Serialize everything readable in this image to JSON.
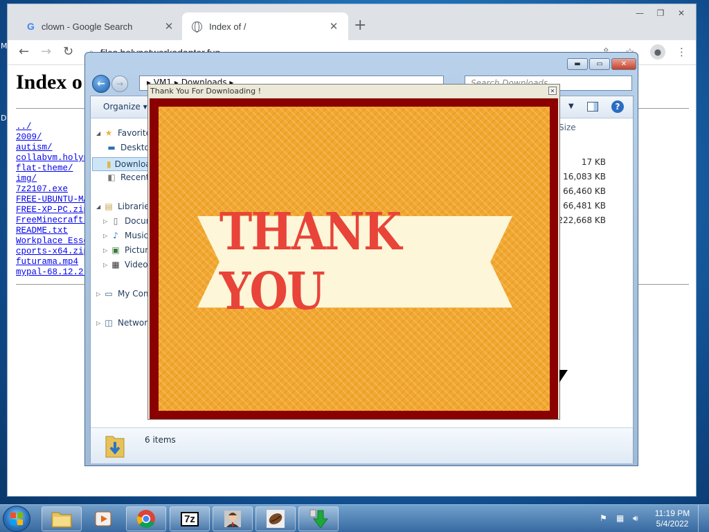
{
  "chrome": {
    "tabs": [
      {
        "label": "clown - Google Search",
        "icon": "google-icon"
      },
      {
        "label": "Index of /",
        "icon": "globe-icon"
      }
    ],
    "new_tab": "+",
    "address": "files.holynetworkadapter.fun",
    "nav": {
      "back": "←",
      "forward": "→",
      "reload": "↻"
    },
    "window_controls": {
      "minimize": "—",
      "restore": "❐",
      "close": "✕"
    }
  },
  "page": {
    "title": "Index o",
    "listing": [
      "../",
      "2009/",
      "autism/",
      "collabvm.holyn",
      "flat-theme/",
      "img/",
      "7z2107.exe",
      "FREE-UBUNTU-MA",
      "FREE-XP-PC.zip",
      "FreeMinecraft.",
      "README.txt",
      "Workplace Esse",
      "cports-x64.zip",
      "futurama.mp4",
      "mypal-68.12.2."
    ]
  },
  "left_edge": {
    "m": "M",
    "d": "D"
  },
  "explorer": {
    "address": "▸ VM1 ▸ Downloads ▸",
    "search_placeholder": "Search Downloads",
    "organize": "Organize ▾",
    "nav": {
      "favorites": "Favorites",
      "desktop": "Desktop",
      "downloads": "Downloads",
      "recent": "Recent Places",
      "libraries": "Libraries",
      "documents": "Documents",
      "music": "Music",
      "pictures": "Pictures",
      "videos": "Videos",
      "computer": "My Computer",
      "network": "Network"
    },
    "size_header": "Size",
    "sizes": [
      "17 KB",
      "16,083 KB",
      "66,460 KB",
      "66,481 KB",
      "222,668 KB"
    ],
    "status": "6 items"
  },
  "popup": {
    "title": "Thank You For Downloading !",
    "banner": "THANK YOU",
    "colors": {
      "frame": "#8b0000",
      "background": "#f2a830",
      "banner": "#fdf6d8",
      "text": "#e8443a"
    }
  },
  "taskbar": {
    "apps": [
      "explorer-icon",
      "media-player-icon",
      "chrome-icon",
      "7zip-icon",
      "user-app-icon",
      "coffee-bean-icon",
      "download-arrow-icon"
    ],
    "sevenzip": "7z",
    "time": "11:19 PM",
    "date": "5/4/2022"
  }
}
